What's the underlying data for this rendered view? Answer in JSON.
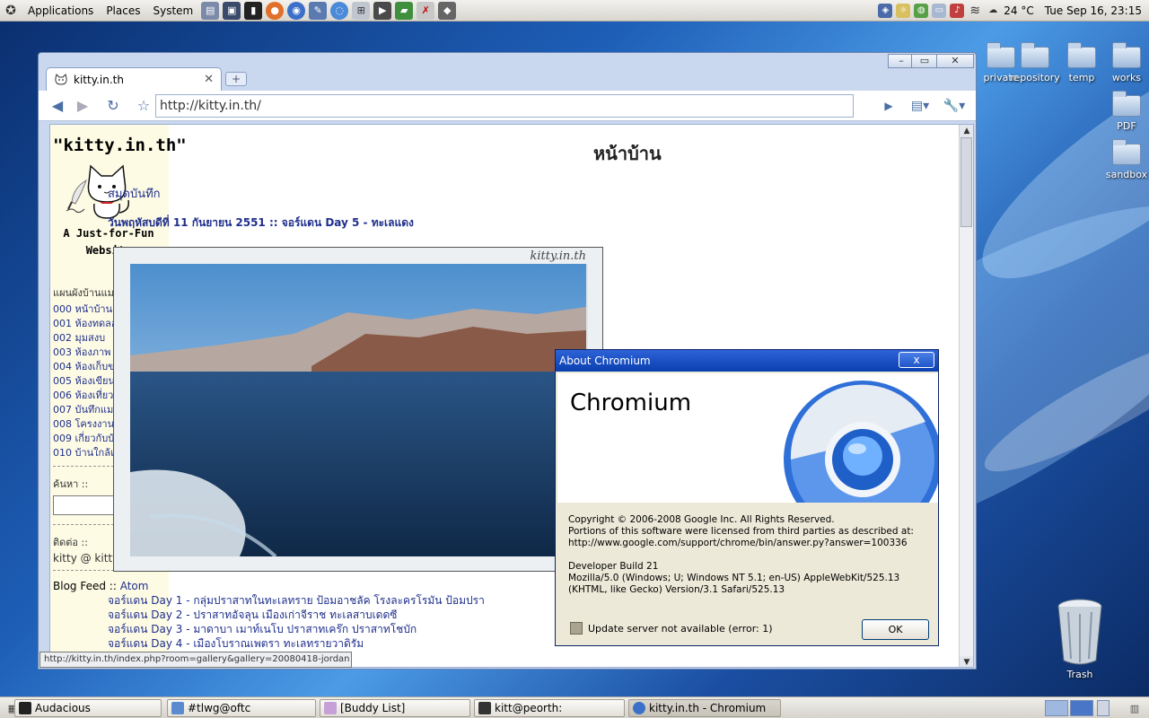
{
  "top_panel": {
    "menus": [
      "Applications",
      "Places",
      "System"
    ],
    "temperature": "24 °C",
    "clock": "Tue Sep 16, 23:15"
  },
  "desktop": {
    "icons": [
      {
        "label": "private"
      },
      {
        "label": "repository"
      },
      {
        "label": "temp"
      },
      {
        "label": "works"
      },
      {
        "label": "PDF"
      },
      {
        "label": "sandbox"
      },
      {
        "label": "Trash"
      }
    ]
  },
  "browser": {
    "tab_title": "kitty.in.th",
    "url": "http://kitty.in.th/",
    "status_url": "http://kitty.in.th/index.php?room=gallery&gallery=20080418-jordan",
    "site": {
      "title": "\"kitty.in.th\"",
      "tagline": "A Just-for-Fun Website",
      "nav_heading": "แผนผังบ้านแมว ::",
      "nav_items": [
        {
          "num": "000",
          "label": "หน้าบ้าน"
        },
        {
          "num": "001",
          "label": "ห้องทดลอง"
        },
        {
          "num": "002",
          "label": "มุมสงบ"
        },
        {
          "num": "003",
          "label": "ห้องภาพ"
        },
        {
          "num": "004",
          "label": "ห้องเก็บของ"
        },
        {
          "num": "005",
          "label": "ห้องเขียนหนังสือ"
        },
        {
          "num": "006",
          "label": "ห้องเที่ยว"
        },
        {
          "num": "007",
          "label": "บันทึกแมวๆ"
        },
        {
          "num": "008",
          "label": "โครงงาน"
        },
        {
          "num": "009",
          "label": "เกี่ยวกับบ้านแมว"
        },
        {
          "num": "010",
          "label": "บ้านใกล้เรือนเคียง"
        }
      ],
      "search_label": "ค้นหา ::",
      "contact_label": "ติดต่อ ::",
      "contact_value": "kitty @ kitty . in . th",
      "blog_feed_label": "Blog Feed ::",
      "atom_link": "Atom",
      "page_heading": "หน้าบ้าน",
      "journal_link": "สมุดบันทึก",
      "entry_line": "วันพฤหัสบดีที่ 11 กันยายน 2551 :: จอร์แดน Day 5 - ทะเลแดง",
      "photo_watermark": "kitty.in.th",
      "day_links": [
        "จอร์แดน Day 1 - กลุ่มปราสาทในทะเลทราย ป้อมอาชลัค โรงละครโรมัน ป้อมปรา",
        "จอร์แดน Day 2 - ปราสาทอัจลุน เมืองเก่าจีราช ทะเลสาบเดดซี",
        "จอร์แดน Day 3 - มาดาบา เมาท์เนโบ ปราสาทเคร๊ก ปราสาทโชบัก",
        "จอร์แดน Day 4 - เมืองโบราณเพตรา ทะเลทรายวาดิรัม"
      ]
    }
  },
  "about_dialog": {
    "title": "About Chromium",
    "close_label": "x",
    "product_name": "Chromium",
    "copyright": "Copyright © 2006-2008 Google Inc. All Rights Reserved.",
    "license_line1": "Portions of this software were licensed from third parties as described at:",
    "license_line2": "http://www.google.com/support/chrome/bin/answer.py?answer=100336",
    "build": "Developer Build 21",
    "useragent": "Mozilla/5.0 (Windows; U; Windows NT 5.1; en-US) AppleWebKit/525.13 (KHTML, like Gecko) Version/3.1 Safari/525.13",
    "update_status": "Update server not available (error: 1)",
    "ok_label": "OK"
  },
  "taskbar": {
    "tasks": [
      {
        "label": "Audacious"
      },
      {
        "label": "#tlwg@oftc"
      },
      {
        "label": "[Buddy List]"
      },
      {
        "label": "kitt@peorth: ~/works/w..."
      },
      {
        "label": "kitty.in.th - Chromium"
      }
    ]
  },
  "colors": {
    "link": "#1f2f8c",
    "xp_title": "#0a3fb1",
    "chrome_blue": "#2f6fd8"
  }
}
